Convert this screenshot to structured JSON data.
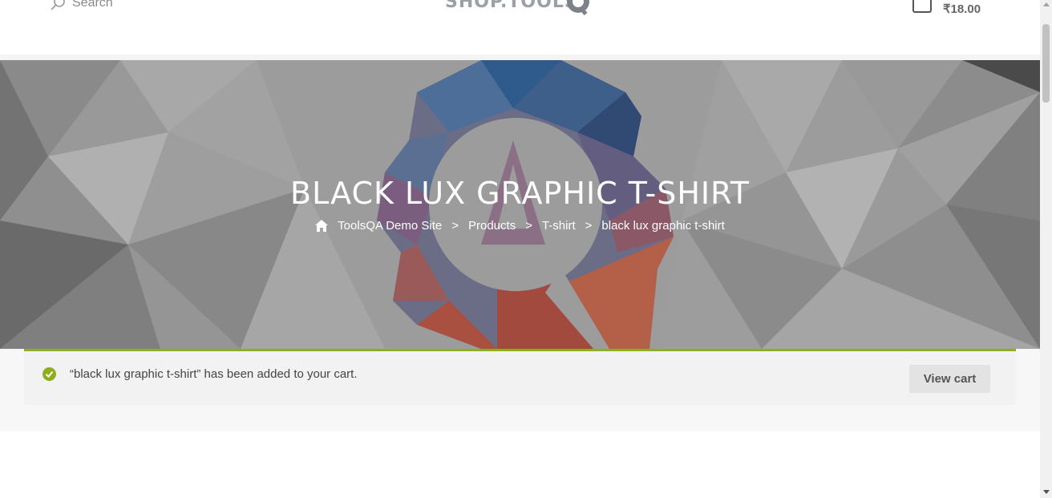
{
  "header": {
    "search_placeholder": "Search",
    "logo_text": "SHOP.TOOLS",
    "cart_total": "₹18.00"
  },
  "hero": {
    "title": "BLACK LUX GRAPHIC T-SHIRT",
    "breadcrumb": {
      "home": "ToolsQA Demo Site",
      "sep": ">",
      "items": [
        "Products",
        "T-shirt",
        "black lux graphic t-shirt"
      ]
    }
  },
  "notice": {
    "message": "“black lux graphic t-shirt” has been added to your cart.",
    "button_label": "View cart"
  },
  "colors": {
    "accent_green": "#8fae1b",
    "hero_gray": "#9c9c9c"
  }
}
